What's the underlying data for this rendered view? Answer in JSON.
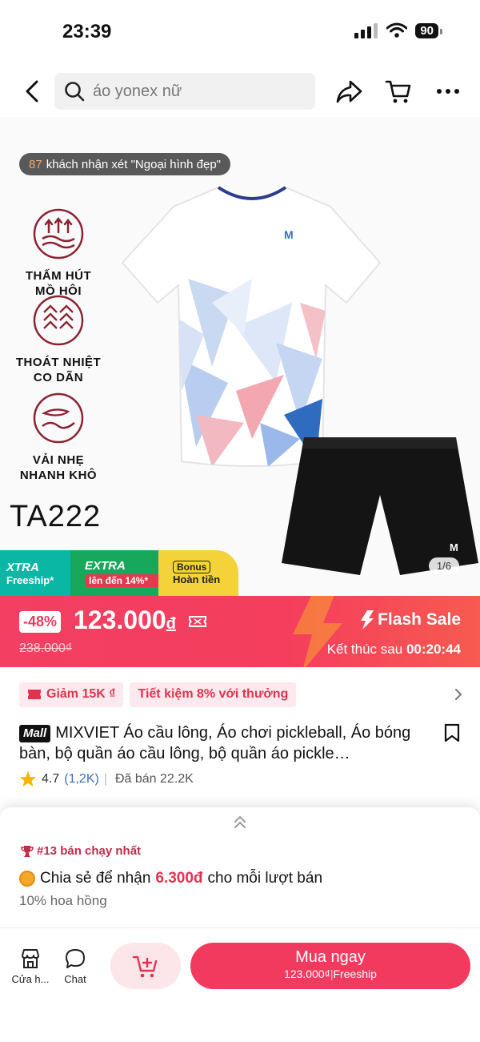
{
  "status_bar": {
    "time": "23:39",
    "battery": "90"
  },
  "search": {
    "query": "áo yonex nữ"
  },
  "hero": {
    "review_count": "87",
    "review_text": "khách nhận xét \"Ngoại hình đẹp\"",
    "features": [
      {
        "line1": "THẤM HÚT",
        "line2": "MỒ HÔI"
      },
      {
        "line1": "THOÁT NHIỆT",
        "line2": "CO DÃN"
      },
      {
        "line1": "VẢI NHẸ",
        "line2": "NHANH KHÔ"
      }
    ],
    "model_code": "TA222",
    "image_counter": "1/6",
    "promos": {
      "xtra": "XTRA",
      "freeship": "Freeship*",
      "extra": "EXTRA",
      "extra_tag": "lên đến 14%*",
      "bonus": "Bonus",
      "cashback": "Hoàn tiền"
    }
  },
  "flash_sale": {
    "discount": "-48%",
    "price": "123.000",
    "currency": "đ",
    "original_price": "238.000₫",
    "label": "Flash Sale",
    "ends_prefix": "Kết thúc sau",
    "countdown": "00:20:44"
  },
  "coupons": [
    {
      "text": "Giảm 15K ₫"
    },
    {
      "text": "Tiết kiệm 8% với thưởng"
    }
  ],
  "product": {
    "mall_badge": "Mall",
    "title": "MIXVIET Áo cầu lông, Áo  chơi pickleball, Áo bóng bàn, bộ quần áo cầu lông, bộ quần áo pickle…",
    "rating": "4.7",
    "reviews": "(1,2K)",
    "sold": "Đã bán 22.2K"
  },
  "affiliate": {
    "bestseller": "#13 bán chạy nhất",
    "share_prefix": "Chia sẻ để nhận",
    "share_amount": "6.300đ",
    "share_suffix": "cho mỗi lượt bán",
    "commission": "10% hoa hồng"
  },
  "bottom_bar": {
    "shop": "Cửa h...",
    "chat": "Chat",
    "buy_now": "Mua ngay",
    "buy_price": "123.000₫",
    "buy_freeship": "Freeship"
  },
  "colors": {
    "accent": "#f23a5f",
    "brand_red": "#e0334f",
    "feature_ring": "#8b2332"
  }
}
